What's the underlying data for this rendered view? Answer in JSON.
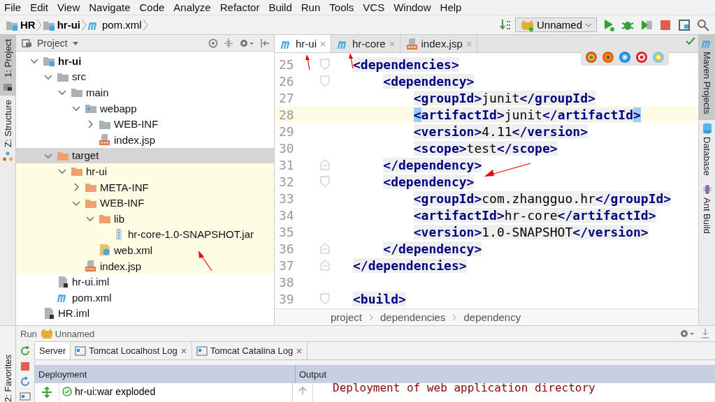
{
  "menu": [
    {
      "label": "File"
    },
    {
      "label": "Edit"
    },
    {
      "label": "View"
    },
    {
      "label": "Navigate"
    },
    {
      "label": "Code"
    },
    {
      "label": "Analyze"
    },
    {
      "label": "Refactor"
    },
    {
      "label": "Build"
    },
    {
      "label": "Run"
    },
    {
      "label": "Tools"
    },
    {
      "label": "VCS"
    },
    {
      "label": "Window"
    },
    {
      "label": "Help"
    }
  ],
  "breadcrumb": [
    {
      "label": "HR",
      "kind": "module"
    },
    {
      "label": "hr-ui",
      "kind": "module"
    },
    {
      "label": "pom.xml",
      "kind": "maven"
    }
  ],
  "run_configuration": "Unnamed",
  "left_strip": [
    {
      "label": "1: Project",
      "selected": true
    },
    {
      "label": "Z: Structure",
      "selected": false
    }
  ],
  "favorites_label": "2: Favorites",
  "project_panel": {
    "title": "Project",
    "tree": [
      {
        "label": "hr-ui",
        "kind": "module",
        "bold": true,
        "expanded": true,
        "selected": false,
        "excluded": false,
        "children": [
          {
            "label": "src",
            "kind": "folder",
            "expanded": true,
            "selected": false,
            "excluded": false,
            "children": [
              {
                "label": "main",
                "kind": "folder",
                "expanded": true,
                "selected": false,
                "excluded": false,
                "children": [
                  {
                    "label": "webapp",
                    "kind": "webroot",
                    "expanded": true,
                    "selected": false,
                    "excluded": false,
                    "children": [
                      {
                        "label": "WEB-INF",
                        "kind": "folder",
                        "expanded": false,
                        "selected": false,
                        "excluded": false
                      },
                      {
                        "label": "index.jsp",
                        "kind": "jsp",
                        "selected": false,
                        "excluded": false
                      }
                    ]
                  }
                ]
              }
            ]
          },
          {
            "label": "target",
            "kind": "excluded-folder",
            "expanded": true,
            "selected": true,
            "excluded": false,
            "children": [
              {
                "label": "hr-ui",
                "kind": "excluded-folder",
                "expanded": true,
                "selected": false,
                "excluded": true,
                "children": [
                  {
                    "label": "META-INF",
                    "kind": "excluded-folder",
                    "expanded": false,
                    "selected": false,
                    "excluded": true
                  },
                  {
                    "label": "WEB-INF",
                    "kind": "excluded-folder",
                    "expanded": true,
                    "selected": false,
                    "excluded": true,
                    "children": [
                      {
                        "label": "lib",
                        "kind": "excluded-folder",
                        "expanded": true,
                        "selected": false,
                        "excluded": true,
                        "children": [
                          {
                            "label": "hr-core-1.0-SNAPSHOT.jar",
                            "kind": "jar",
                            "selected": false,
                            "excluded": true
                          }
                        ]
                      },
                      {
                        "label": "web.xml",
                        "kind": "webxml",
                        "selected": false,
                        "excluded": true
                      }
                    ]
                  },
                  {
                    "label": "index.jsp",
                    "kind": "jsp",
                    "selected": false,
                    "excluded": true
                  }
                ]
              }
            ]
          },
          {
            "label": "hr-ui.iml",
            "kind": "iml",
            "selected": false,
            "excluded": false
          },
          {
            "label": "pom.xml",
            "kind": "maven",
            "selected": false,
            "excluded": false
          }
        ]
      },
      {
        "label": "HR.iml",
        "kind": "iml",
        "selected": false,
        "excluded": false
      }
    ]
  },
  "editor": {
    "tabs": [
      {
        "label": "hr-ui",
        "kind": "maven",
        "selected": true
      },
      {
        "label": "hr-core",
        "kind": "maven",
        "selected": false
      },
      {
        "label": "index.jsp",
        "kind": "jsp",
        "selected": false
      }
    ],
    "lines": [
      {
        "number": "25",
        "code": "<dependencies>",
        "fold_start": true,
        "current": false
      },
      {
        "number": "26",
        "code": "    <dependency>",
        "fold_start": true,
        "current": false
      },
      {
        "number": "27",
        "code": "        <groupId>junit</groupId>",
        "current": false
      },
      {
        "number": "28",
        "code": "        <artifactId>junit</artifactId>",
        "current": true,
        "brace_match": true
      },
      {
        "number": "29",
        "code": "        <version>4.11</version>",
        "current": false
      },
      {
        "number": "30",
        "code": "        <scope>test</scope>",
        "current": false
      },
      {
        "number": "31",
        "code": "    </dependency>",
        "fold_end": true,
        "current": false
      },
      {
        "number": "32",
        "code": "    <dependency>",
        "fold_start": true,
        "current": false
      },
      {
        "number": "33",
        "code": "        <groupId>com.zhangguo.hr</groupId>",
        "current": false
      },
      {
        "number": "34",
        "code": "        <artifactId>hr-core</artifactId>",
        "current": false
      },
      {
        "number": "35",
        "code": "        <version>1.0-SNAPSHOT</version>",
        "current": false
      },
      {
        "number": "36",
        "code": "    </dependency>",
        "fold_end": true,
        "current": false
      },
      {
        "number": "37",
        "code": "</dependencies>",
        "fold_end": true,
        "current": false
      },
      {
        "number": "38",
        "current": false
      },
      {
        "number": "39",
        "code": "<build>",
        "fold_start": true,
        "current": false
      }
    ],
    "path": [
      "project",
      "dependencies",
      "dependency"
    ]
  },
  "right_strip": [
    {
      "label": "Maven Projects",
      "kind": "maven",
      "selected": true
    },
    {
      "label": "Database",
      "kind": "database",
      "selected": false
    },
    {
      "label": "Ant Build",
      "kind": "ant",
      "selected": false
    }
  ],
  "run_panel": {
    "title": "Run",
    "configuration": "Unnamed",
    "tabs": [
      {
        "label": "Server",
        "selected": true,
        "closable": false
      },
      {
        "label": "Tomcat Localhost Log",
        "selected": false,
        "closable": true
      },
      {
        "label": "Tomcat Catalina Log",
        "selected": false,
        "closable": true
      }
    ],
    "columns": [
      "Deployment",
      "Output"
    ],
    "deployments": [
      {
        "label": "hr-ui:war exploded"
      }
    ],
    "output": "Deployment of web application directory"
  }
}
